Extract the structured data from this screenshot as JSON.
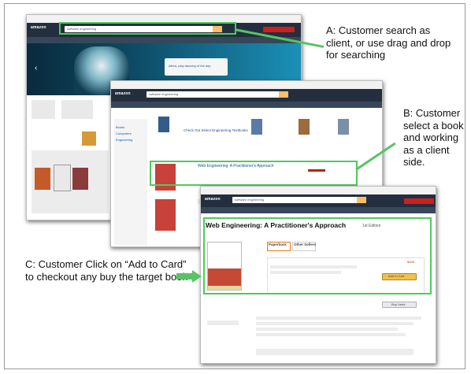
{
  "annotations": {
    "a_text": "A: Customer search as client, or use drag and drop for searching",
    "b_text": "B: Customer select a book and working as a client side.",
    "c_text": "C: Customer Click on “Add to Card” to checkout any buy the target book"
  },
  "screen_a": {
    "logo": "amazon",
    "search_value": "software engineering",
    "banner_text": "Alexa, play dancing of the day"
  },
  "screen_b": {
    "logo": "amazon",
    "search_value": "software engineering",
    "selected_book_title": "Web Engineering: A Practitioner's Approach",
    "side_box_title": "Check Out Select Engineering Textbooks"
  },
  "screen_c": {
    "logo": "amazon",
    "search_value": "software engineering",
    "book_title": "Web Engineering: A Practitioner's Approach",
    "edition": "1st Edition",
    "format_tab_1": "Paperback",
    "format_tab_2": "Other Sellers",
    "price": "$100",
    "add_to_cart_label": "Add to Cart",
    "buy_used_label": "Buy Used"
  },
  "colors": {
    "highlight": "#4fca5c",
    "arrow": "#57c464",
    "amazon_nav": "#232f3e",
    "cart_button": "#f0c14b"
  }
}
